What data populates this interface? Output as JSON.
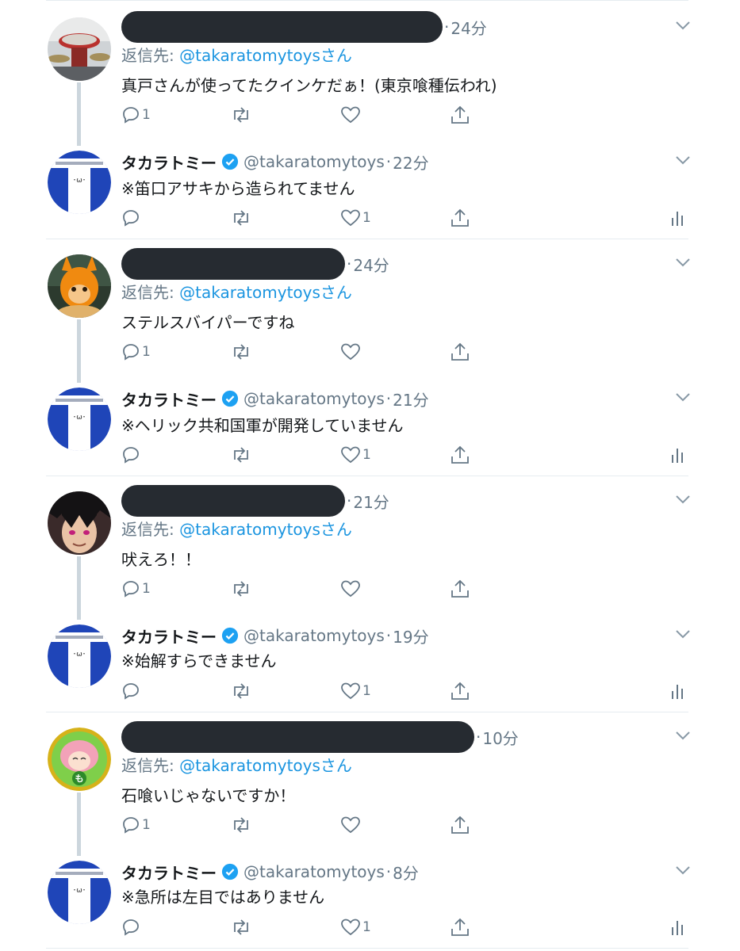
{
  "conversations": [
    {
      "reply": {
        "time": "24分",
        "reply_label": "返信先:",
        "mention": "@takaratomytoys",
        "mention_suffix": "さん",
        "text": "真戸さんが使ってたクインケだぁ！(東京喰種伝われ)",
        "reply_count": "1"
      },
      "official": {
        "name": "タカラトミー",
        "handle": "@takaratomytoys",
        "time": "22分",
        "text": "※笛口アサキから造られてません",
        "like_count": "1"
      }
    },
    {
      "reply": {
        "time": "24分",
        "reply_label": "返信先:",
        "mention": "@takaratomytoys",
        "mention_suffix": "さん",
        "text": "ステルスバイパーですね",
        "reply_count": "1"
      },
      "official": {
        "name": "タカラトミー",
        "handle": "@takaratomytoys",
        "time": "21分",
        "text": "※ヘリック共和国軍が開発していません",
        "like_count": "1"
      }
    },
    {
      "reply": {
        "time": "21分",
        "reply_label": "返信先:",
        "mention": "@takaratomytoys",
        "mention_suffix": "さん",
        "text": "吠えろ！！",
        "reply_count": "1"
      },
      "official": {
        "name": "タカラトミー",
        "handle": "@takaratomytoys",
        "time": "19分",
        "text": "※始解すらできません",
        "like_count": "1"
      }
    },
    {
      "reply": {
        "time": "10分",
        "reply_label": "返信先:",
        "mention": "@takaratomytoys",
        "mention_suffix": "さん",
        "text": "石喰いじゃないですか！",
        "reply_count": "1"
      },
      "official": {
        "name": "タカラトミー",
        "handle": "@takaratomytoys",
        "time": "8分",
        "text": "※急所は左目ではありません",
        "like_count": "1"
      }
    }
  ],
  "colors": {
    "link": "#1b95e0",
    "secondary_text": "#657786",
    "verified": "#1da1f2",
    "official_avatar_blue": "#1f45b8"
  },
  "icons": [
    "reply-icon",
    "retweet-icon",
    "like-icon",
    "share-icon",
    "analytics-icon",
    "caret-down-icon",
    "verified-badge-icon"
  ]
}
